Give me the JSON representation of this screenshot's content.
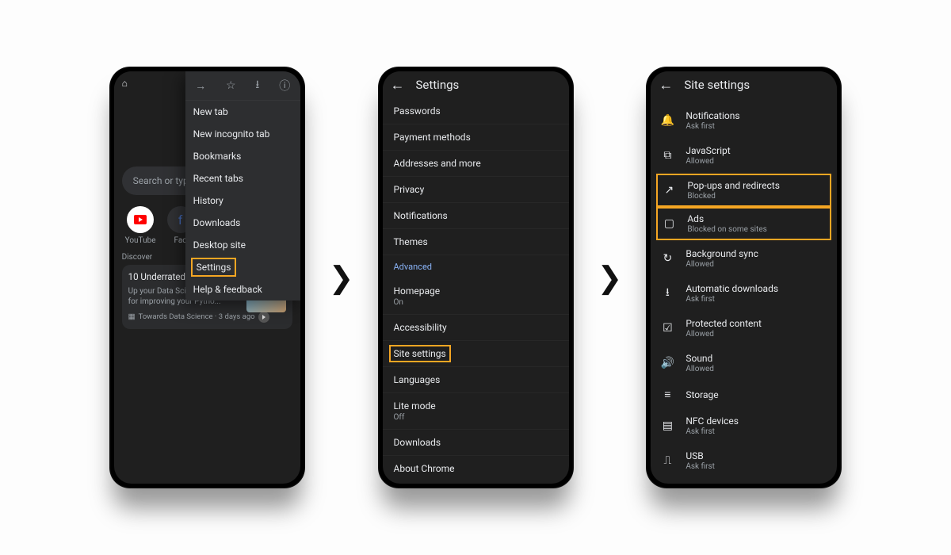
{
  "highlight_color": "#f5a623",
  "phone1": {
    "search_placeholder": "Search or type w",
    "tiles": [
      {
        "label": "YouTube"
      },
      {
        "label": "Fac"
      }
    ],
    "discover_label": "Discover",
    "card": {
      "title": "10 Underrated P\nNicole Janeway",
      "subtitle": "Up your Data Science game with these tips for improving your Pytho...",
      "sourceicon": "▦",
      "source": "Towards Data Science · 3 days ago"
    },
    "menu_icons": [
      "→",
      "☆",
      "⭳",
      "ⓘ"
    ],
    "menu_items": [
      {
        "label": "New tab"
      },
      {
        "label": "New incognito tab"
      },
      {
        "label": "Bookmarks"
      },
      {
        "label": "Recent tabs"
      },
      {
        "label": "History"
      },
      {
        "label": "Downloads"
      },
      {
        "label": "Desktop site"
      },
      {
        "label": "Settings",
        "highlight": true
      },
      {
        "label": "Help & feedback"
      }
    ]
  },
  "phone2": {
    "title": "Settings",
    "items": [
      {
        "label": "Passwords"
      },
      {
        "label": "Payment methods"
      },
      {
        "label": "Addresses and more"
      },
      {
        "label": "Privacy"
      },
      {
        "label": "Notifications"
      },
      {
        "label": "Themes"
      }
    ],
    "advanced_label": "Advanced",
    "items2": [
      {
        "label": "Homepage",
        "sub": "On"
      },
      {
        "label": "Accessibility"
      },
      {
        "label": "Site settings",
        "highlight": true
      },
      {
        "label": "Languages"
      },
      {
        "label": "Lite mode",
        "sub": "Off"
      },
      {
        "label": "Downloads"
      },
      {
        "label": "About Chrome"
      }
    ]
  },
  "phone3": {
    "title": "Site settings",
    "items": [
      {
        "icon": "🔔",
        "label": "Notifications",
        "sub": "Ask first"
      },
      {
        "icon": "⧉",
        "label": "JavaScript",
        "sub": "Allowed"
      },
      {
        "icon": "↗",
        "label": "Pop-ups and redirects",
        "sub": "Blocked",
        "highlight": true
      },
      {
        "icon": "▢",
        "label": "Ads",
        "sub": "Blocked on some sites",
        "highlight": true
      },
      {
        "icon": "↻",
        "label": "Background sync",
        "sub": "Allowed"
      },
      {
        "icon": "⭳",
        "label": "Automatic downloads",
        "sub": "Ask first"
      },
      {
        "icon": "☑",
        "label": "Protected content",
        "sub": "Allowed"
      },
      {
        "icon": "🔊",
        "label": "Sound",
        "sub": "Allowed"
      },
      {
        "icon": "≡",
        "label": "Storage",
        "sub": ""
      },
      {
        "icon": "▤",
        "label": "NFC devices",
        "sub": "Ask first"
      },
      {
        "icon": "⎍",
        "label": "USB",
        "sub": "Ask first"
      }
    ]
  }
}
